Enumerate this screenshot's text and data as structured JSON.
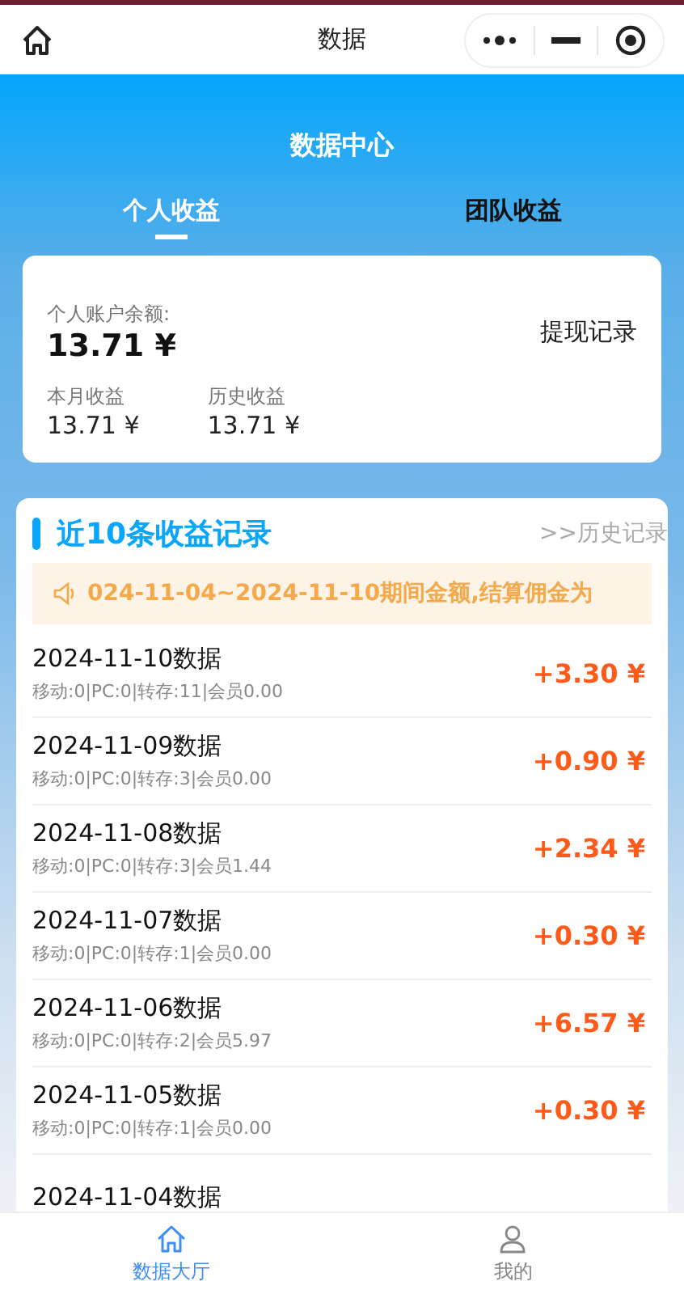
{
  "nav": {
    "title": "数据"
  },
  "header": {
    "title": "数据中心"
  },
  "tabs": [
    {
      "label": "个人收益",
      "selected": true
    },
    {
      "label": "团队收益",
      "selected": false
    }
  ],
  "balance": {
    "label": "个人账户余额:",
    "value": "13.71 ¥",
    "action": "提现记录",
    "stats": [
      {
        "label": "本月收益",
        "value": "13.71 ¥"
      },
      {
        "label": "历史收益",
        "value": "13.71 ¥"
      }
    ]
  },
  "records": {
    "title": "近10条收益记录",
    "link": ">>历史记录",
    "notice": "024-11-04~2024-11-10期间金额,结算佣金为",
    "rows": [
      {
        "date": "2024-11-10数据",
        "detail": "移动:0|PC:0|转存:11|会员0.00",
        "amount": "+3.30 ¥"
      },
      {
        "date": "2024-11-09数据",
        "detail": "移动:0|PC:0|转存:3|会员0.00",
        "amount": "+0.90 ¥"
      },
      {
        "date": "2024-11-08数据",
        "detail": "移动:0|PC:0|转存:3|会员1.44",
        "amount": "+2.34 ¥"
      },
      {
        "date": "2024-11-07数据",
        "detail": "移动:0|PC:0|转存:1|会员0.00",
        "amount": "+0.30 ¥"
      },
      {
        "date": "2024-11-06数据",
        "detail": "移动:0|PC:0|转存:2|会员5.97",
        "amount": "+6.57 ¥"
      },
      {
        "date": "2024-11-05数据",
        "detail": "移动:0|PC:0|转存:1|会员0.00",
        "amount": "+0.30 ¥"
      },
      {
        "date": "2024-11-04数据"
      }
    ]
  },
  "tabbar": [
    {
      "label": "数据大厅",
      "kind": "home",
      "selected": true
    },
    {
      "label": "我的",
      "kind": "user",
      "selected": false
    }
  ]
}
